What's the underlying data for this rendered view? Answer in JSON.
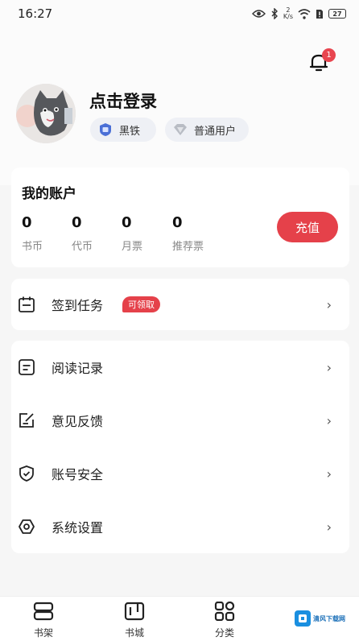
{
  "status_bar": {
    "time": "16:27",
    "net_speed_value": "2",
    "net_speed_unit": "K/s",
    "battery": "27"
  },
  "notification": {
    "badge_count": "1"
  },
  "profile": {
    "login_text": "点击登录",
    "level_tag": "黑铁",
    "user_type_tag": "普通用户"
  },
  "account": {
    "title": "我的账户",
    "stats": [
      {
        "value": "0",
        "label": "书币"
      },
      {
        "value": "0",
        "label": "代币"
      },
      {
        "value": "0",
        "label": "月票"
      },
      {
        "value": "0",
        "label": "推荐票"
      }
    ],
    "recharge_label": "充值"
  },
  "menu": {
    "checkin": {
      "label": "签到任务",
      "badge": "可领取"
    },
    "items": [
      {
        "label": "阅读记录",
        "icon": "reading-record-icon"
      },
      {
        "label": "意见反馈",
        "icon": "feedback-icon"
      },
      {
        "label": "账号安全",
        "icon": "shield-icon"
      },
      {
        "label": "系统设置",
        "icon": "settings-icon"
      }
    ]
  },
  "bottom_nav": {
    "items": [
      {
        "label": "书架",
        "icon": "bookshelf-icon"
      },
      {
        "label": "书城",
        "icon": "bookstore-icon"
      },
      {
        "label": "分类",
        "icon": "category-icon"
      }
    ]
  },
  "watermark": {
    "text": "清风下载网"
  },
  "colors": {
    "accent": "#e5414a",
    "background": "#f6f6f6",
    "card": "#ffffff",
    "tag_bg": "#eef0f5",
    "watermark_blue": "#1a8fe0"
  }
}
